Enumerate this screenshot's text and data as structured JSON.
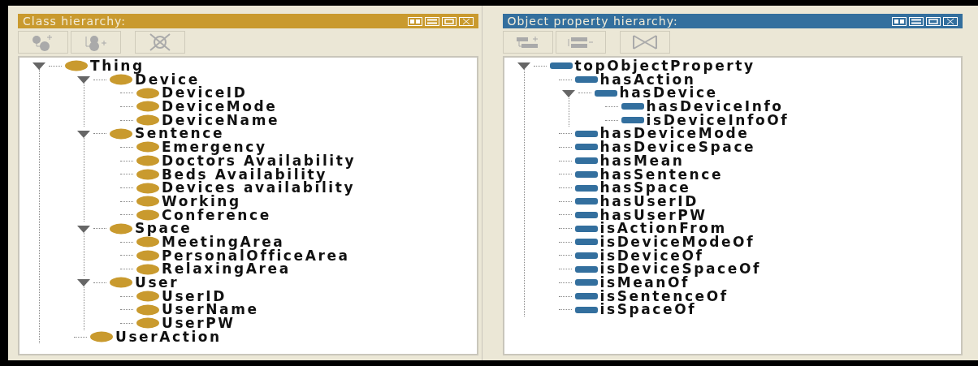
{
  "panels": [
    {
      "kind": "class",
      "title": "Class hierarchy:",
      "tree": [
        {
          "label": "Thing",
          "expanded": true,
          "children": [
            {
              "label": "Device",
              "expanded": true,
              "children": [
                {
                  "label": "DeviceID"
                },
                {
                  "label": "DeviceMode"
                },
                {
                  "label": "DeviceName"
                }
              ]
            },
            {
              "label": "Sentence",
              "expanded": true,
              "children": [
                {
                  "label": "Emergency"
                },
                {
                  "label": "Doctors Availability"
                },
                {
                  "label": "Beds Availability"
                },
                {
                  "label": "Devices availability"
                },
                {
                  "label": "Working"
                },
                {
                  "label": "Conference"
                }
              ]
            },
            {
              "label": "Space",
              "expanded": true,
              "children": [
                {
                  "label": "MeetingArea"
                },
                {
                  "label": "PersonalOfficeArea"
                },
                {
                  "label": "RelaxingArea"
                }
              ]
            },
            {
              "label": "User",
              "expanded": true,
              "children": [
                {
                  "label": "UserID"
                },
                {
                  "label": "UserName"
                },
                {
                  "label": "UserPW"
                }
              ]
            },
            {
              "label": "UserAction"
            }
          ]
        }
      ]
    },
    {
      "kind": "property",
      "title": "Object property hierarchy:",
      "tree": [
        {
          "label": "topObjectProperty",
          "expanded": true,
          "children": [
            {
              "label": "hasAction"
            },
            {
              "label": "hasDevice",
              "expanded": true,
              "children": [
                {
                  "label": "hasDeviceInfo"
                },
                {
                  "label": "isDeviceInfoOf"
                }
              ]
            },
            {
              "label": "hasDeviceMode"
            },
            {
              "label": "hasDeviceSpace"
            },
            {
              "label": "hasMean"
            },
            {
              "label": "hasSentence"
            },
            {
              "label": "hasSpace"
            },
            {
              "label": "hasUserID"
            },
            {
              "label": "hasUserPW"
            },
            {
              "label": "isActionFrom"
            },
            {
              "label": "isDeviceModeOf"
            },
            {
              "label": "isDeviceOf"
            },
            {
              "label": "isDeviceSpaceOf"
            },
            {
              "label": "isMeanOf"
            },
            {
              "label": "isSentenceOf"
            },
            {
              "label": "isSpaceOf"
            }
          ]
        }
      ]
    }
  ]
}
